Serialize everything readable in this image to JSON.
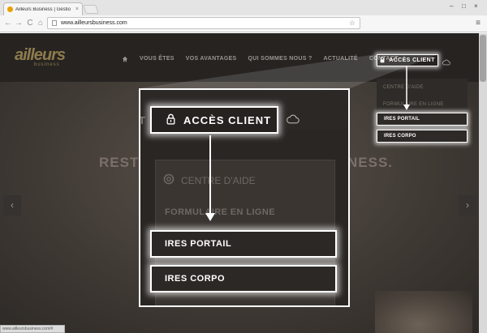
{
  "browser": {
    "tab_title": "Ailleurs Business | Gestio",
    "tab_close": "×",
    "url": "www.ailleursbusiness.com",
    "back": "←",
    "forward": "→",
    "reload": "C",
    "home": "⌂",
    "star": "☆",
    "menu": "≡",
    "win_min": "–",
    "win_max": "□",
    "win_close": "×"
  },
  "site": {
    "logo_main": "ailleurs",
    "logo_sub": "business",
    "nav": [
      {
        "label": "VOUS ÊTES"
      },
      {
        "label": "VOS AVANTAGES"
      },
      {
        "label": "QUI SOMMES NOUS ?"
      },
      {
        "label": "ACTUALITÉ"
      },
      {
        "label": "CONTACT"
      }
    ],
    "client_access": "ACCÈS CLIENT",
    "dropdown": {
      "help": "CENTRE D'AIDE",
      "form": "FORMULAIRE EN LIGNE",
      "portal": "IRES PORTAIL",
      "corpo": "IRES CORPO"
    },
    "headline_left": "RESTE",
    "headline_right": "NESS.",
    "prev": "‹",
    "next": "›",
    "status_url": "www.ailleursbusiness.com/#"
  },
  "zoom": {
    "client_access": "ACCÈS CLIENT",
    "partial_left": "T",
    "help": "CENTRE D'AIDE",
    "form": "FORMULAIRE EN LIGNE",
    "portal": "IRES PORTAIL",
    "corpo": "IRES CORPO"
  },
  "icons": {
    "home": "home-icon",
    "lock": "lock-icon",
    "cloud": "cloud-icon",
    "help": "help-icon",
    "star": "star-icon"
  },
  "colors": {
    "header_bg": "#262321",
    "logo": "#8e7b4c",
    "highlight": "#ffffff",
    "site_bg": "#403a35"
  }
}
